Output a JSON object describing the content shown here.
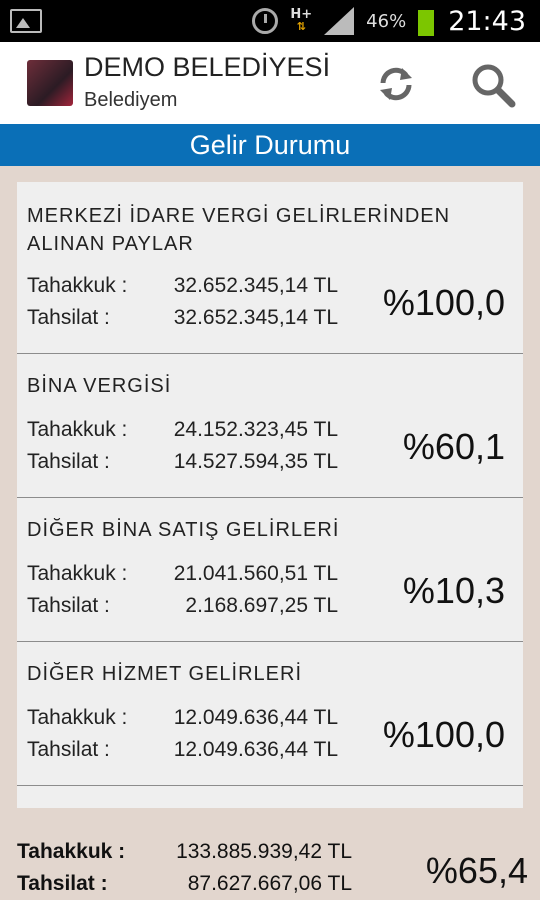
{
  "status_bar": {
    "battery_percent": "46%",
    "time": "21:43",
    "network": "H+",
    "icons": [
      "gallery-icon",
      "alarm-icon",
      "hplus-data-icon",
      "signal-icon",
      "battery-icon"
    ]
  },
  "app_bar": {
    "title": "DEMO BELEDİYESİ",
    "subtitle": "Belediyem",
    "actions": [
      "refresh-icon",
      "search-icon"
    ]
  },
  "section": {
    "title": "Gelir Durumu"
  },
  "labels": {
    "tahakkuk": "Tahakkuk :",
    "tahsilat": "Tahsilat :"
  },
  "items": [
    {
      "name": "MERKEZİ İDARE VERGİ GELİRLERİNDEN ALINAN PAYLAR",
      "tahakkuk": "32.652.345,14 TL",
      "tahsilat": "32.652.345,14 TL",
      "percent": "%100,0"
    },
    {
      "name": "BİNA VERGİSİ",
      "tahakkuk": "24.152.323,45 TL",
      "tahsilat": "14.527.594,35 TL",
      "percent": "%60,1"
    },
    {
      "name": "DİĞER BİNA SATIŞ GELİRLERİ",
      "tahakkuk": "21.041.560,51 TL",
      "tahsilat": "2.168.697,25 TL",
      "percent": "%10,3"
    },
    {
      "name": "DİĞER HİZMET GELİRLERİ",
      "tahakkuk": "12.049.636,44 TL",
      "tahsilat": "12.049.636,44 TL",
      "percent": "%100,0"
    }
  ],
  "totals": {
    "tahakkuk_label": "Tahakkuk :",
    "tahsilat_label": "Tahsilat :",
    "tahakkuk": "133.885.939,42 TL",
    "tahsilat": "87.627.667,06 TL",
    "percent": "%65,4"
  },
  "colors": {
    "accent": "#0a6fb7",
    "background": "#e2d6ce",
    "card": "#efefef"
  }
}
